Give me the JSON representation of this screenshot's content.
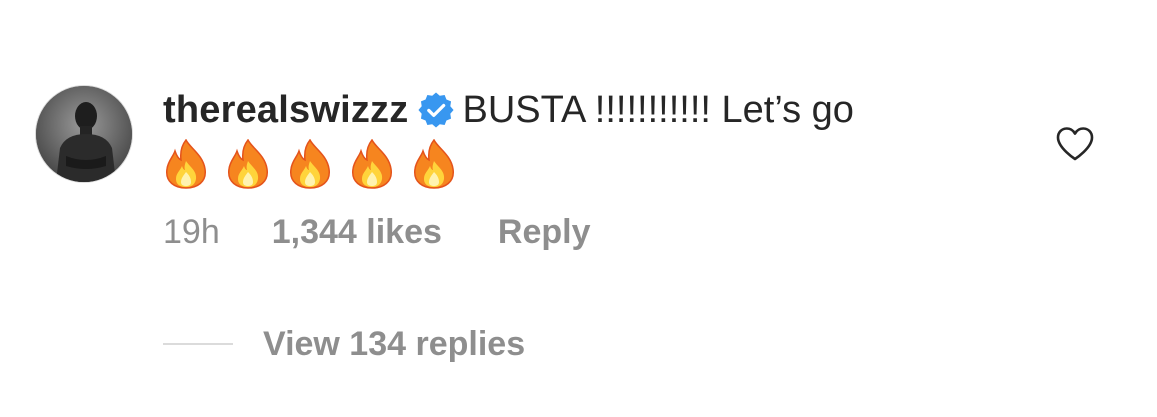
{
  "comment": {
    "username": "therealswizzz",
    "verified": true,
    "text": "BUSTA !!!!!!!!!!! Let’s go",
    "emojis": [
      "fire-emoji",
      "fire-emoji",
      "fire-emoji",
      "fire-emoji",
      "fire-emoji"
    ],
    "time": "19h",
    "likes": "1,344 likes",
    "reply_label": "Reply",
    "view_replies": "View 134 replies"
  },
  "colors": {
    "text": "#262626",
    "secondary": "#8e8e8e",
    "verified_blue": "#3897f0",
    "divider": "#dbdbdb"
  },
  "icons": {
    "verified": "verified-badge-icon",
    "like": "heart-outline-icon"
  }
}
